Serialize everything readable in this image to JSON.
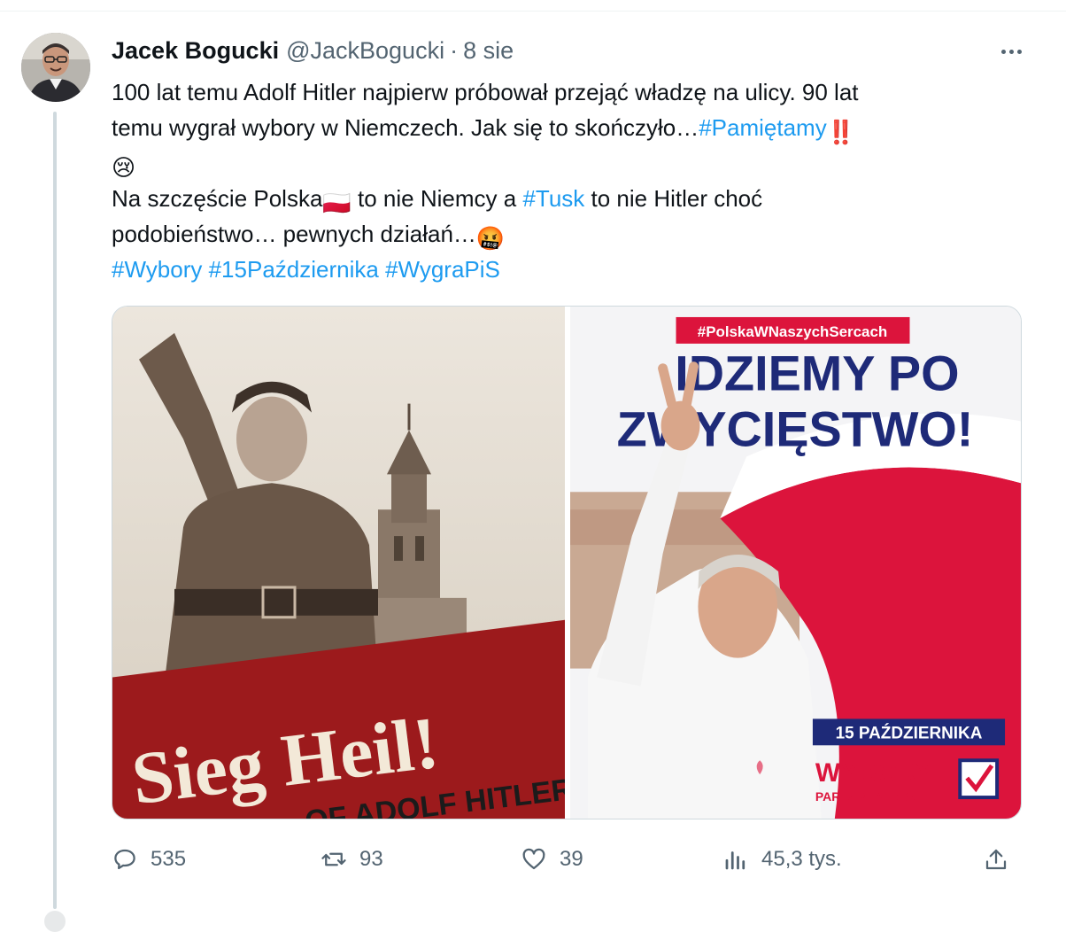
{
  "tweet": {
    "display_name": "Jacek Bogucki",
    "handle": "@JackBogucki",
    "separator": "·",
    "date": "8 sie",
    "text": {
      "l1": "100 lat temu Adolf Hitler najpierw próbował przejąć władzę na ulicy. 90 lat",
      "l2a": "temu wygrał wybory w Niemczech. Jak się to skończyło…",
      "l2_hashtag": "#Pamiętamy",
      "l2_emoji": "‼️",
      "l3_emoji": "😢",
      "l4a": "Na szczęście Polska",
      "l4_flag": "🇵🇱",
      "l4b": " to nie Niemcy a ",
      "l4_hashtag": "#Tusk",
      "l4c": " to nie Hitler choć",
      "l5a": "podobieństwo… pewnych działań…",
      "l5_emoji": "🤬",
      "hashtag_1": "#Wybory",
      "hashtag_2": "#15Października",
      "hashtag_3": "#WygraPiS"
    }
  },
  "media": {
    "left_image": {
      "banner_text": "Sieg Heil!",
      "subtitle_text": "OF ADOLF HITLER"
    },
    "right_image": {
      "top_tag": "#PolskaWNaszychSercach",
      "headline_1": "IDZIEMY PO",
      "headline_2": "ZWYCIĘSTWO!",
      "date_text": "15 PAŹDZIERNIKA",
      "logo_main": "WYBORY",
      "logo_sub": "PARLAMENTARNE"
    }
  },
  "actions": {
    "replies": "535",
    "reposts": "93",
    "likes": "39",
    "views": "45,3 tys."
  },
  "colors": {
    "hashtag": "#1d9bf0",
    "muted": "#536471",
    "banner_red": "#9c1a1c",
    "poster_navy": "#1e2a78",
    "poster_red": "#dc143c"
  }
}
